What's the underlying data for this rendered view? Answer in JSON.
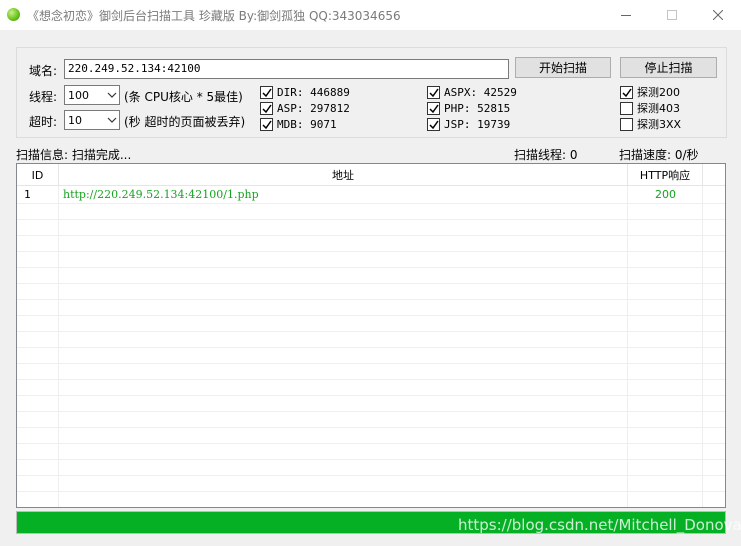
{
  "window": {
    "title": "《想念初恋》御剑后台扫描工具 珍藏版 By:御剑孤独 QQ:343034656"
  },
  "form": {
    "domain_label": "域名:",
    "domain_value": "220.249.52.134:42100",
    "threads_label": "线程:",
    "threads_value": "100",
    "threads_hint": "(条 CPU核心 * 5最佳)",
    "timeout_label": "超时:",
    "timeout_value": "10",
    "timeout_hint": "(秒 超时的页面被丢弃)",
    "start_button": "开始扫描",
    "stop_button": "停止扫描"
  },
  "dicts": [
    {
      "label": "DIR: 446889",
      "checked": true
    },
    {
      "label": "ASP: 297812",
      "checked": true
    },
    {
      "label": "MDB: 9071",
      "checked": true
    },
    {
      "label": "ASPX: 42529",
      "checked": true
    },
    {
      "label": "PHP: 52815",
      "checked": true
    },
    {
      "label": "JSP: 19739",
      "checked": true
    }
  ],
  "probes": [
    {
      "label": "探测200",
      "checked": true
    },
    {
      "label": "探测403",
      "checked": false
    },
    {
      "label": "探测3XX",
      "checked": false
    }
  ],
  "status": {
    "info": "扫描信息: 扫描完成...",
    "threads": "扫描线程: 0",
    "speed": "扫描速度: 0/秒"
  },
  "table": {
    "columns": [
      "ID",
      "地址",
      "HTTP响应"
    ],
    "rows": [
      {
        "id": "1",
        "url": "http://220.249.52.134:42100/1.php",
        "code": "200"
      }
    ]
  },
  "progress": {
    "percent": 100,
    "color": "#06b025"
  },
  "watermark": "https://blog.csdn.net/Mitchell_Donovan"
}
